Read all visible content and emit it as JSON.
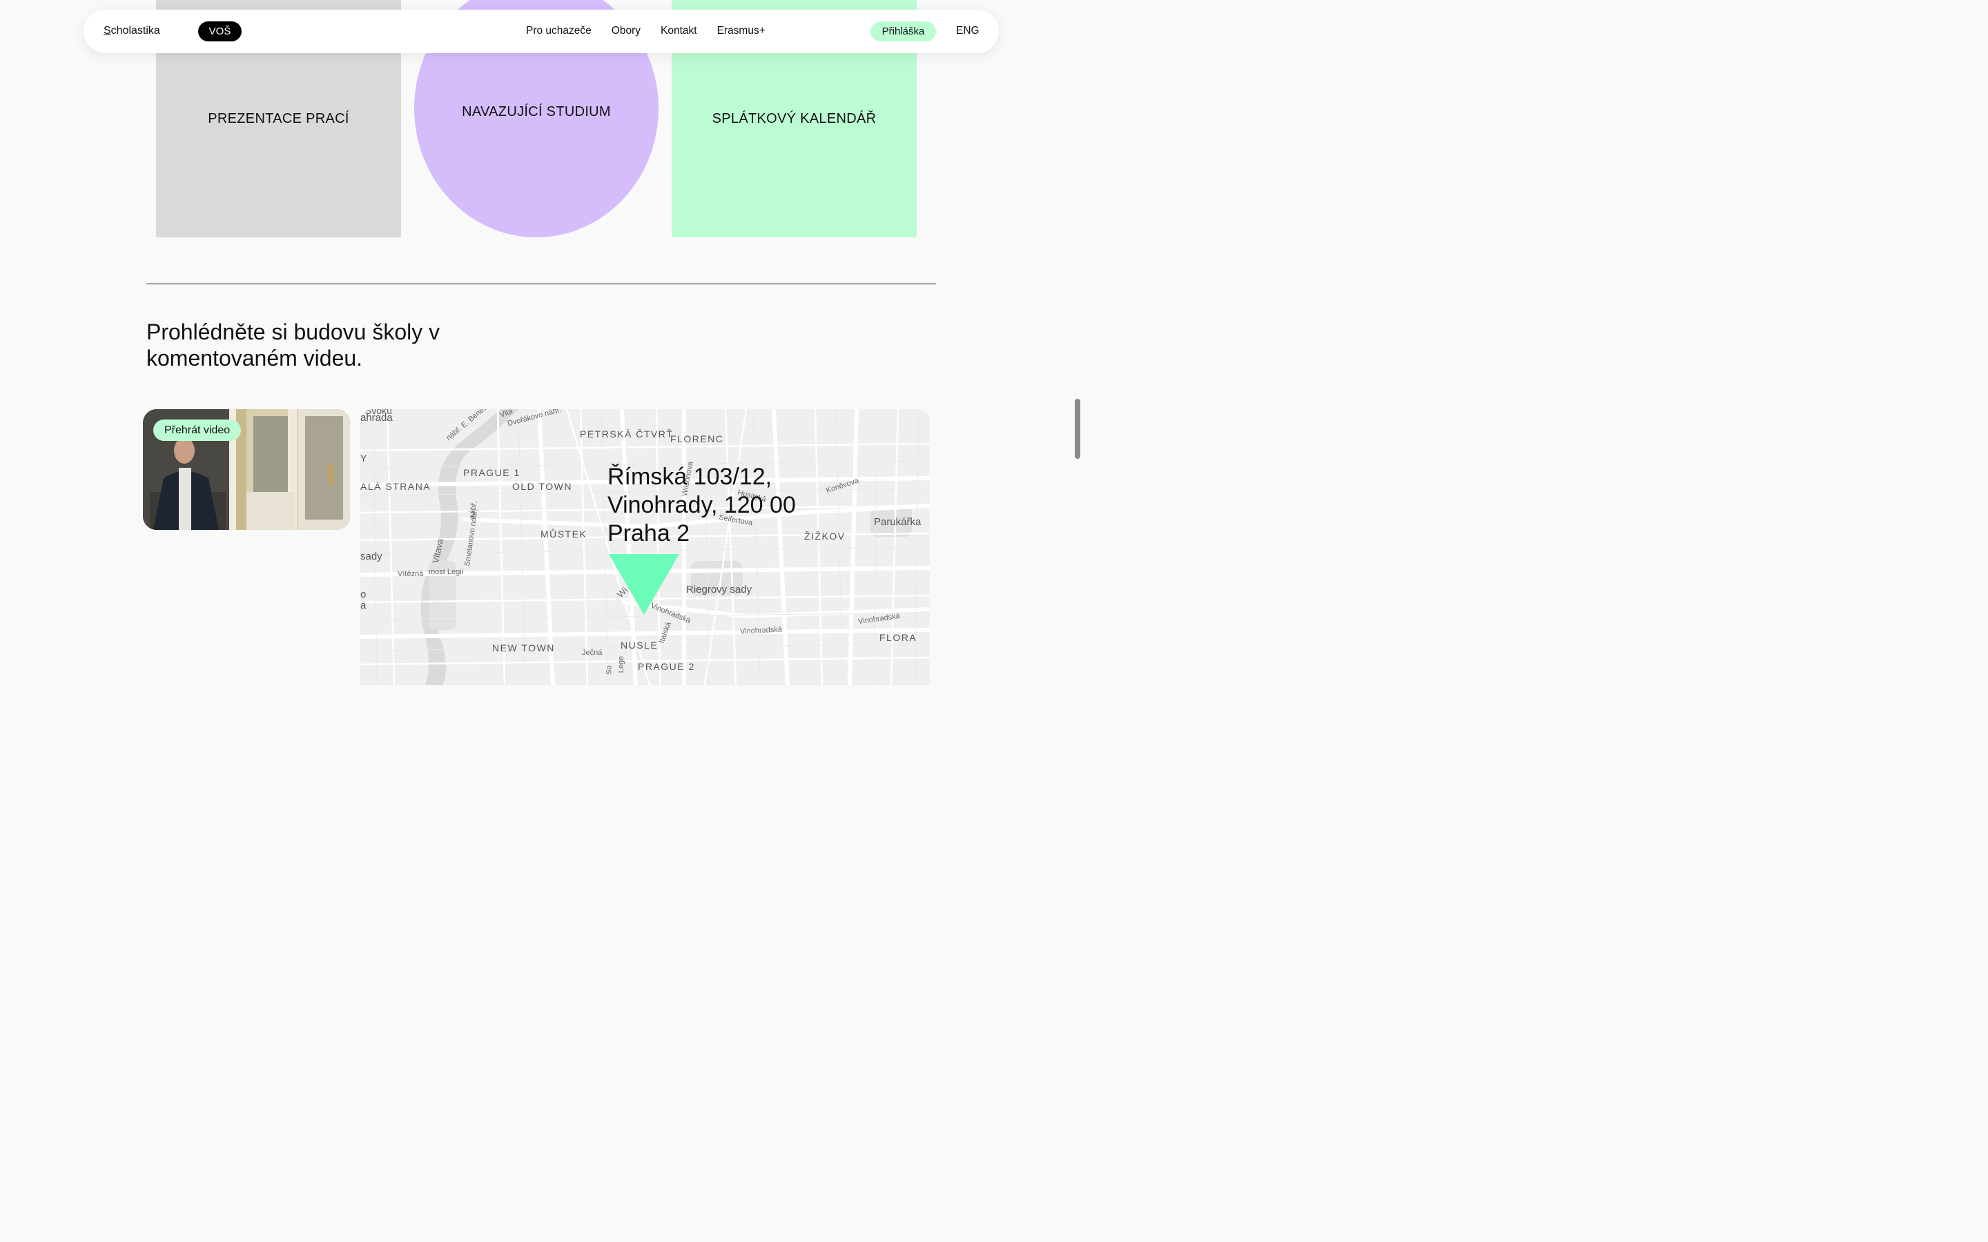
{
  "cards": [
    {
      "label": "PREZENTACE PRACÍ",
      "color": "#d9d9d9"
    },
    {
      "label": "NAVAZUJÍCÍ STUDIUM",
      "color": "#d5bdfc"
    },
    {
      "label": "SPLÁTKOVÝ KALENDÁŘ",
      "color": "#bcfcd3"
    }
  ],
  "navbar": {
    "brand": "Scholastika",
    "brand_first": "S",
    "brand_rest": "cholastika",
    "vos_label": "VOŠ",
    "links": [
      "Pro uchazeče",
      "Obory",
      "Kontakt",
      "Erasmus+"
    ],
    "apply_label": "Přihláška",
    "lang_label": "ENG"
  },
  "section": {
    "heading": "Prohlédněte si budovu školy v komentovaném videu."
  },
  "video": {
    "play_label": "Přehrát video"
  },
  "map": {
    "address_lines": [
      "Římská 103/12,",
      "Vinohrady, 120 00",
      "Praha 2"
    ],
    "district_labels": {
      "petrska": "PETRSKÁ ČTVRŤ",
      "florenc": "FLORENC",
      "prague1": "PRAGUE 1",
      "old_town": "OLD TOWN",
      "mala_strana": "ALÁ STRANA",
      "mustek": "MŮSTEK",
      "zizkov": "ŽIŽKOV",
      "new_town": "NEW TOWN",
      "nusle": "NUSLE",
      "prague2": "PRAGUE 2",
      "flora": "FLORA",
      "y": "Y"
    },
    "place_labels": {
      "parukarka": "Parukářka",
      "riegrovy": "Riegrovy sady",
      "sady": "sady",
      "ahrada": "ahrada",
      "o": "o",
      "a": "a"
    },
    "street_labels": {
      "vltava": "Vltava",
      "smetanovo": "Smetanovo nábř.",
      "vitezna": "Vítězná",
      "most_legii": "most Legií",
      "dvorakovo": "Dvořákovo nábř.",
      "nabr_benese": "nábř. E. Beneše",
      "vlta": "Vlta",
      "seifertova": "Seifertova",
      "husitska": "Husitská",
      "konevova": "Koněvova",
      "vinohradska1": "Vinohradská",
      "vinohradska2": "Vinohradská",
      "vinohradska3": "Vinohradská",
      "italska": "Italská",
      "jecna": "Ječná",
      "wilsonova": "Wilsonova",
      "wi": "Wi",
      "nabr": "nábř.",
      "lege": "Lege",
      "so": "So",
      "svoku": "Svoku"
    },
    "marker_color": "#6bfcb9"
  }
}
